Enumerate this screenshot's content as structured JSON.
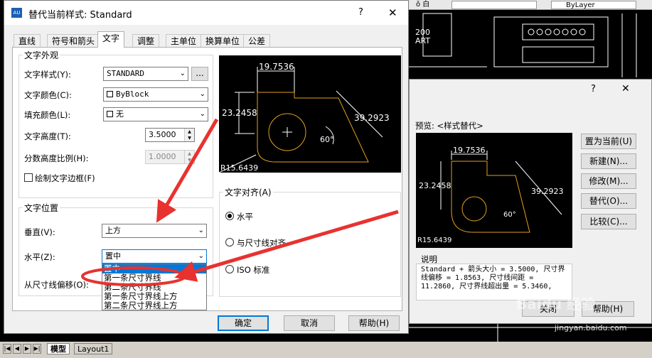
{
  "app": {
    "cad_title_fragment": "er",
    "bylayer": "ByLayer",
    "topbar_left": "ǒ 白",
    "model_tab": "模型",
    "layout_tab": "Layout1",
    "watermark": "Baidu 经验",
    "watermark_url": "jingyan.baidu.com",
    "bg_text1": "200",
    "bg_text2": "ART"
  },
  "dialog": {
    "title": "替代当前样式: Standard",
    "help_glyph": "?",
    "close_glyph": "✕",
    "tabs": [
      "直线",
      "符号和箭头",
      "文字",
      "调整",
      "主单位",
      "换算单位",
      "公差"
    ],
    "active_tab": "文字",
    "appearance": {
      "group_label": "文字外观",
      "style_label": "文字样式(Y):",
      "style_value": "STANDARD",
      "browse_label": "...",
      "color_label": "文字颜色(C):",
      "color_value": "ByBlock",
      "fill_label": "填充颜色(L):",
      "fill_value": "无",
      "height_label": "文字高度(T):",
      "height_value": "3.5000",
      "fraction_label": "分数高度比例(H):",
      "fraction_value": "1.0000",
      "frame_label": "绘制文字边框(F)"
    },
    "placement": {
      "group_label": "文字位置",
      "vertical_label": "垂直(V):",
      "vertical_value": "上方",
      "horizontal_label": "水平(Z):",
      "horizontal_value": "置中",
      "offset_label": "从尺寸线偏移(O):",
      "dropdown_options": [
        "置中",
        "第一条尺寸界线",
        "第二条尺寸界线",
        "第一条尺寸界线上方",
        "第二条尺寸界线上方"
      ]
    },
    "alignment": {
      "group_label": "文字对齐(A)",
      "options": [
        "水平",
        "与尺寸线对齐",
        "ISO 标准"
      ],
      "selected": "水平"
    },
    "preview": {
      "dim_top": "19.7536",
      "dim_left": "23.2458",
      "dim_right": "39.2923",
      "dim_angle": "60°",
      "dim_radius": "R15.6439"
    },
    "buttons": {
      "ok": "确定",
      "cancel": "取消",
      "help": "帮助(H)"
    }
  },
  "dialog2": {
    "help_glyph": "?",
    "close_glyph": "✕",
    "preview_label": "预览: <样式替代>",
    "buttons": [
      "置为当前(U)",
      "新建(N)...",
      "修改(M)...",
      "替代(O)...",
      "比较(C)..."
    ],
    "desc_label": "说明",
    "description": "Standard + 箭头大小 = 3.5000, 尺寸界线偏移 = 1.8563, 尺寸线间距 = 11.2860, 尺寸界线超出量 = 5.3460,",
    "close_button": "关闭",
    "help_button": "帮助(H)"
  },
  "colors": {
    "accent": "#0078d7",
    "annotation": "#e8322f",
    "preview_line": "#e0a020"
  }
}
